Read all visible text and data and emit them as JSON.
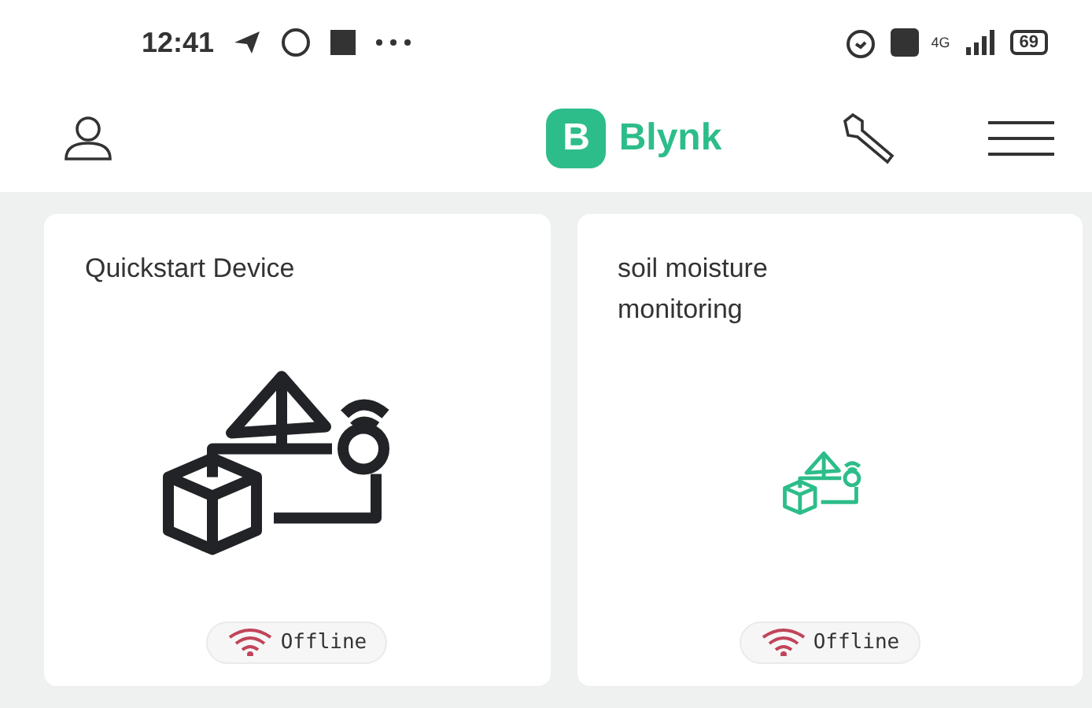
{
  "status_bar": {
    "time": "12:41",
    "network": "4G",
    "battery": "69"
  },
  "header": {
    "logo_letter": "B",
    "logo_name": "Blynk"
  },
  "devices": [
    {
      "name": "Quickstart Device",
      "kind": "large",
      "status": "Offline",
      "online": false
    },
    {
      "name": "soil moisture monitoring",
      "kind": "small",
      "status": "Offline",
      "online": false
    }
  ]
}
